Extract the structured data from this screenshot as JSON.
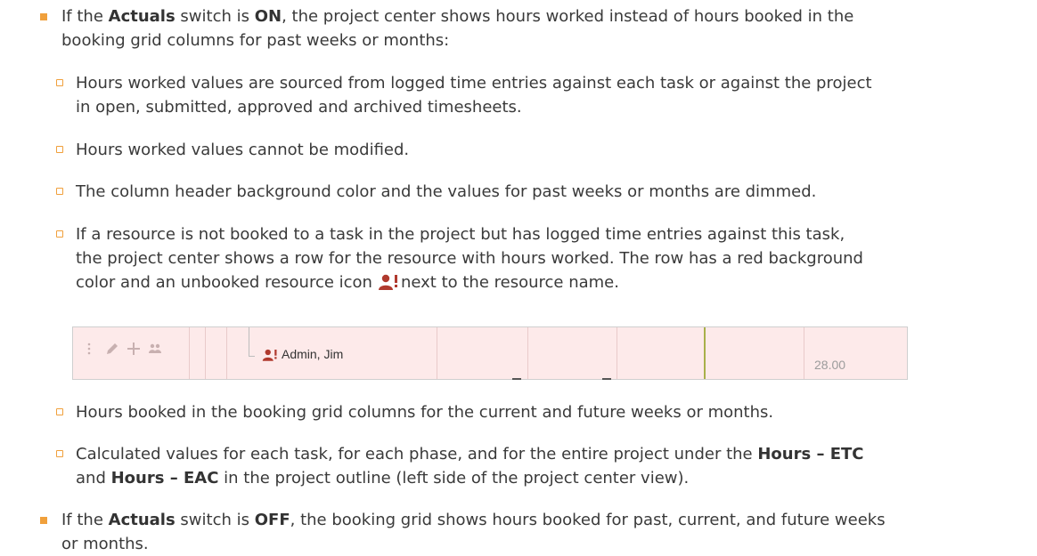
{
  "bullets": {
    "actuals_on": {
      "pre": "If the ",
      "bold1": "Actuals",
      "mid": " switch is ",
      "bold2": "ON",
      "line1_end": ", the project center shows hours worked instead of hours booked in the",
      "line2": "booking grid columns for past weeks or months:"
    },
    "sub1": {
      "line1": "Hours worked values are sourced from logged time entries against each task or against the project",
      "line2": "in open, submitted, approved and archived timesheets."
    },
    "sub2": "Hours worked values cannot be modified.",
    "sub3": "The column header background color and the values for past weeks or months are dimmed.",
    "sub4": {
      "line1": "If a resource is not booked to a task in the project but has logged time entries against this task,",
      "line2": "the project center shows a row for the resource with hours worked. The row has a red background",
      "line3_pre": "color and an unbooked resource icon",
      "line3_post": "next to the resource name."
    },
    "sub5": "Hours booked in the booking grid columns for the current and future weeks or months.",
    "sub6": {
      "line1_pre": "Calculated values for each task, for each phase, and for the entire project under the ",
      "bold1": "Hours – ETC",
      "line2_pre": "and ",
      "bold2": "Hours – EAC",
      "line2_post": " in the project outline (left side of the project center view)."
    },
    "actuals_off": {
      "pre": "If the ",
      "bold1": "Actuals",
      "mid": " switch is ",
      "bold2": "OFF",
      "line1_end": ", the booking grid shows hours booked for past, current, and future weeks",
      "line2": "or months."
    }
  },
  "grid_row": {
    "resource_name": "Admin, Jim",
    "hours_value": "28.00"
  },
  "colors": {
    "bullet": "#f0a03c",
    "row_background": "#fdeaea",
    "unbooked_icon": "#b03a2e"
  }
}
